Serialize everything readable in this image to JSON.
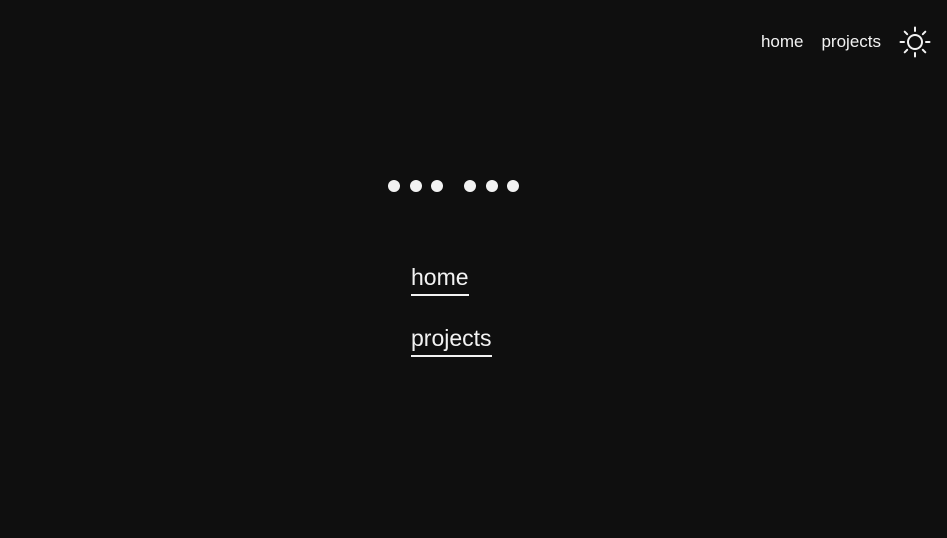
{
  "nav": {
    "home_label": "home",
    "projects_label": "projects",
    "theme_icon": "sun-icon"
  },
  "decoration": {
    "dot_groups": [
      3,
      3
    ]
  },
  "menu": {
    "home_label": "home",
    "projects_label": "projects"
  },
  "colors": {
    "background": "#0f0f0f",
    "foreground": "#f2f2f2"
  }
}
